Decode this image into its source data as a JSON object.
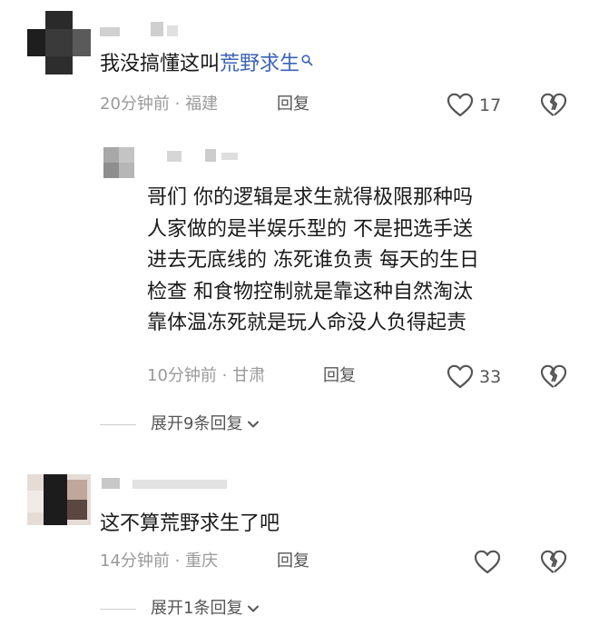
{
  "comments": [
    {
      "text_plain": "我没搞懂这叫",
      "text_link": "荒野求生",
      "link_icon": "search-icon",
      "time": "20分钟前 · 福建",
      "reply_label": "回复",
      "likes": "17",
      "reply": {
        "lines": [
          "哥们 你的逻辑是求生就得极限那种吗",
          "人家做的是半娱乐型的 不是把选手送",
          "进去无底线的 冻死谁负责 每天的生日",
          "检查 和食物控制就是靠这种自然淘汰",
          "靠体温冻死就是玩人命没人负得起责"
        ],
        "time": "10分钟前 · 甘肃",
        "reply_label": "回复",
        "likes": "33"
      },
      "expand_label": "展开9条回复"
    },
    {
      "text": "这不算荒野求生了吧",
      "time": "14分钟前 · 重庆",
      "reply_label": "回复",
      "likes": "",
      "expand_label": "展开1条回复"
    }
  ],
  "icons": {
    "like": "heart-outline-icon",
    "dislike": "broken-heart-icon",
    "expand": "chevron-down-icon"
  },
  "colors": {
    "link": "#3b63b8",
    "meta": "#9a9a9a",
    "text": "#1a1a1a"
  }
}
